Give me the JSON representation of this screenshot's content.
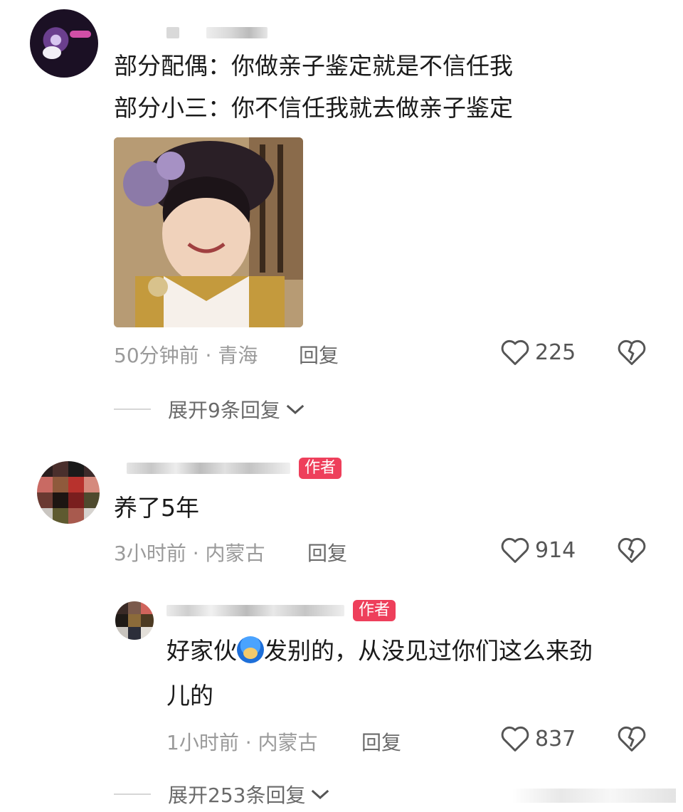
{
  "comments": [
    {
      "text_lines": [
        "部分配偶：你做亲子鉴定就是不信任我",
        "部分小三：你不信任我就去做亲子鉴定"
      ],
      "time_location": "50分钟前 · 青海",
      "reply_label": "回复",
      "likes": "225",
      "expand_label": "展开9条回复"
    },
    {
      "badge": "作者",
      "text_lines": [
        "养了5年"
      ],
      "time_location": "3小时前 · 内蒙古",
      "reply_label": "回复",
      "likes": "914"
    },
    {
      "badge": "作者",
      "text_part1": "好家伙",
      "text_part2": "发别的，从没见过你们这么来劲",
      "text_line2": "儿的",
      "time_location": "1小时前 · 内蒙古",
      "reply_label": "回复",
      "likes": "837",
      "expand_label": "展开253条回复"
    }
  ],
  "colors": {
    "badge": "#ee3f5b",
    "meta": "#9a9a9a"
  },
  "icons": [
    "heart-outline-icon",
    "broken-heart-icon",
    "chevron-down-icon",
    "emoji-icon"
  ]
}
